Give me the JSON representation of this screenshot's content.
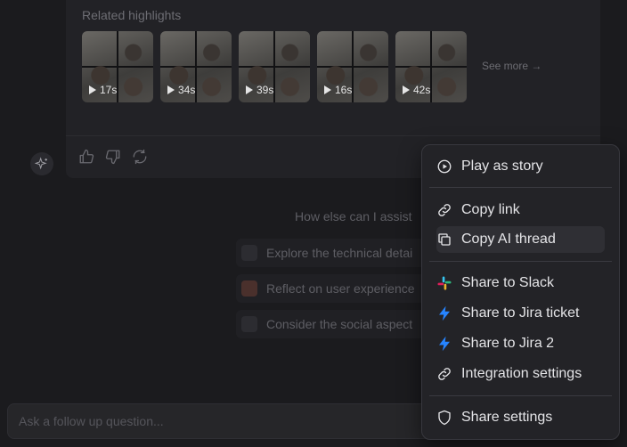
{
  "highlights": {
    "title": "Related highlights",
    "clips": [
      {
        "duration": "17s"
      },
      {
        "duration": "34s"
      },
      {
        "duration": "39s"
      },
      {
        "duration": "16s"
      },
      {
        "duration": "42s"
      }
    ],
    "see_more": "See more →"
  },
  "feedback": {
    "icons": [
      "thumbs-up-icon",
      "thumbs-down-icon",
      "refresh-icon"
    ]
  },
  "suggestions": {
    "title": "How else can I assist",
    "items": [
      {
        "label": "Explore the technical detai",
        "icon": "code-icon"
      },
      {
        "label": "Reflect on user experience",
        "icon": "user-experience-icon"
      },
      {
        "label": "Consider the social aspect",
        "icon": "social-icon"
      }
    ]
  },
  "followup": {
    "placeholder": "Ask a follow up question..."
  },
  "menu": {
    "items": [
      {
        "label": "Play as story",
        "icon": "play-circle-icon"
      },
      {
        "label": "Copy link",
        "icon": "link-icon"
      },
      {
        "label": "Copy AI thread",
        "icon": "copy-icon"
      },
      {
        "label": "Share to Slack",
        "icon": "slack-icon"
      },
      {
        "label": "Share to Jira ticket",
        "icon": "jira-icon"
      },
      {
        "label": "Share to Jira 2",
        "icon": "jira-icon"
      },
      {
        "label": "Integration settings",
        "icon": "link-icon"
      },
      {
        "label": "Share settings",
        "icon": "shield-icon"
      }
    ]
  },
  "colors": {
    "background": "#1b1b1e",
    "menu_background": "#232327",
    "jira_blue": "#2684ff",
    "slack_red": "#e01e5a",
    "slack_green": "#2eb67d",
    "slack_yellow": "#ecb22e",
    "slack_blue": "#36c5f0"
  }
}
